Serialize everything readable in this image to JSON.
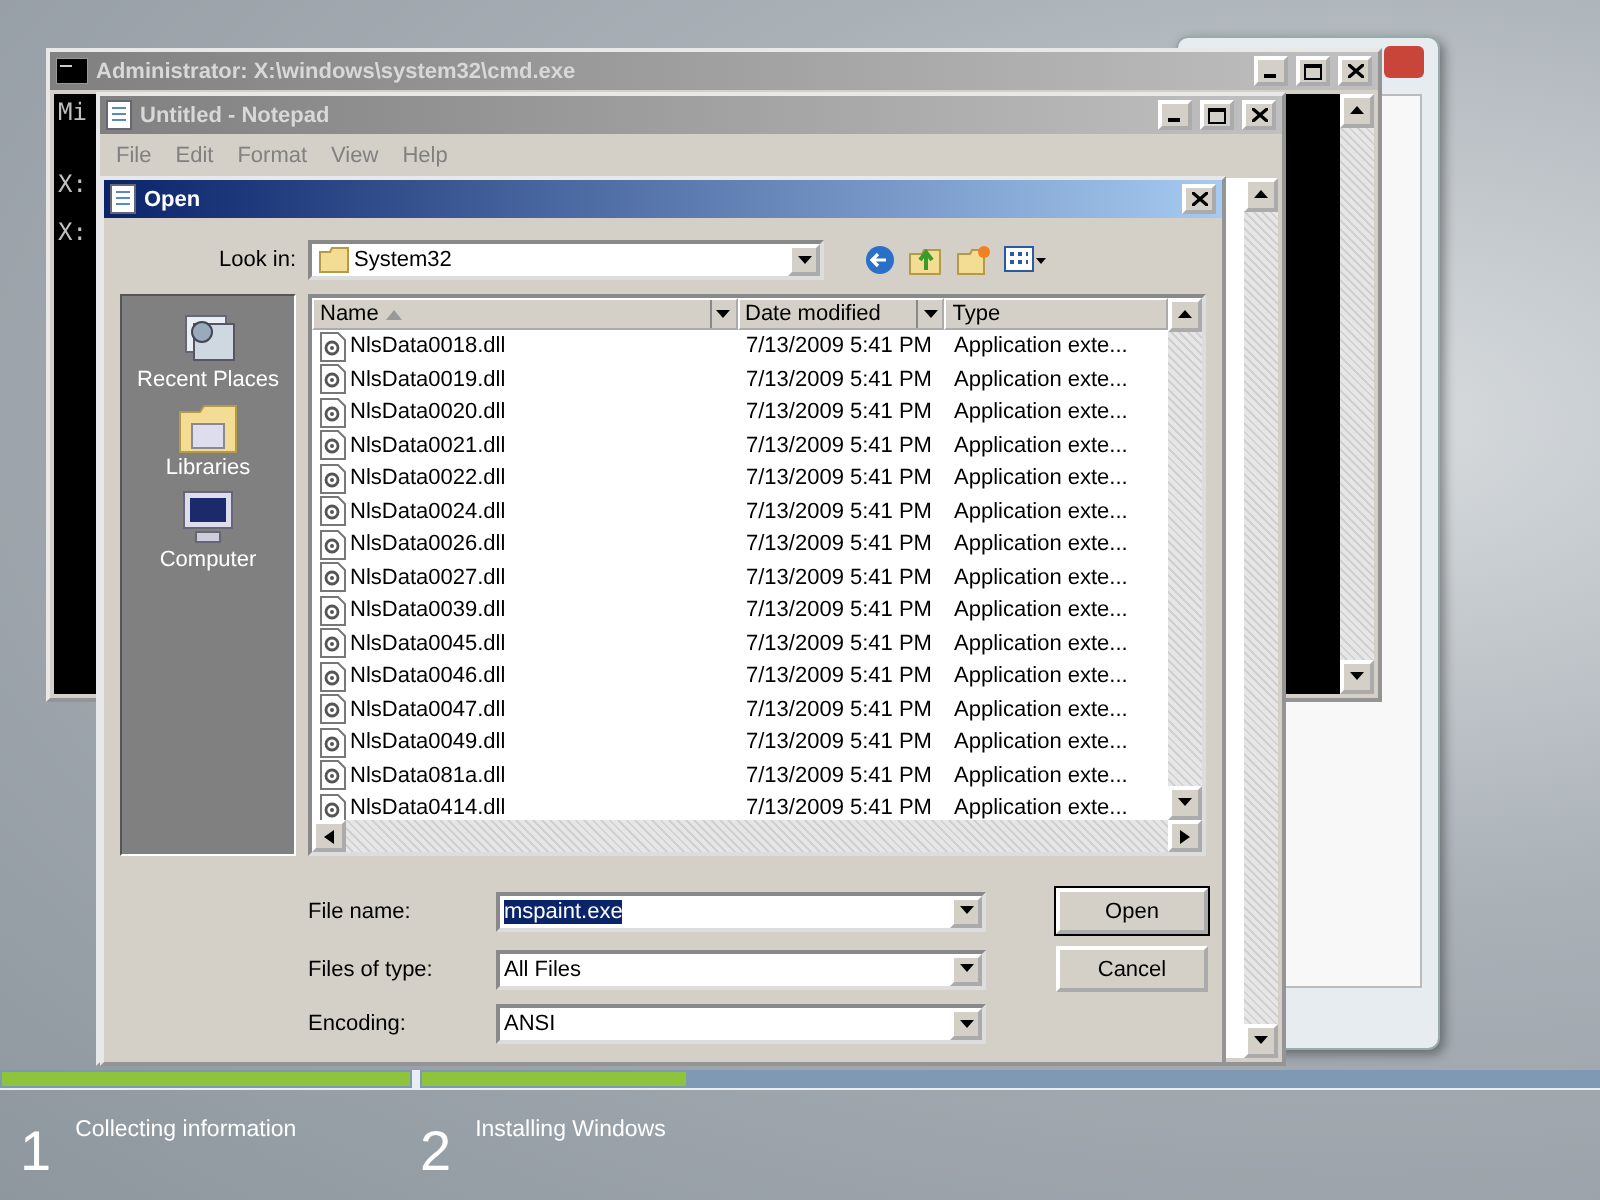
{
  "cmd_window": {
    "title": "Administrator: X:\\windows\\system32\\cmd.exe",
    "active": false,
    "lines": [
      "Mi",
      "X:",
      "X:"
    ]
  },
  "notepad": {
    "title": "Untitled - Notepad",
    "active": false,
    "menu": [
      "File",
      "Edit",
      "Format",
      "View",
      "Help"
    ]
  },
  "open_dialog": {
    "title": "Open",
    "active": true,
    "look_in_label": "Look in:",
    "look_in": "System32",
    "places": [
      {
        "label": "Recent Places",
        "kind": "recent"
      },
      {
        "label": "Libraries",
        "kind": "libraries"
      },
      {
        "label": "Computer",
        "kind": "computer"
      }
    ],
    "columns": [
      {
        "label": "Name",
        "sorted": true
      },
      {
        "label": "Date modified",
        "sorted": false
      },
      {
        "label": "Type",
        "sorted": false
      }
    ],
    "rows": [
      {
        "name": "NlsData0018.dll",
        "date": "7/13/2009 5:41 PM",
        "type": "Application exte..."
      },
      {
        "name": "NlsData0019.dll",
        "date": "7/13/2009 5:41 PM",
        "type": "Application exte..."
      },
      {
        "name": "NlsData0020.dll",
        "date": "7/13/2009 5:41 PM",
        "type": "Application exte..."
      },
      {
        "name": "NlsData0021.dll",
        "date": "7/13/2009 5:41 PM",
        "type": "Application exte..."
      },
      {
        "name": "NlsData0022.dll",
        "date": "7/13/2009 5:41 PM",
        "type": "Application exte..."
      },
      {
        "name": "NlsData0024.dll",
        "date": "7/13/2009 5:41 PM",
        "type": "Application exte..."
      },
      {
        "name": "NlsData0026.dll",
        "date": "7/13/2009 5:41 PM",
        "type": "Application exte..."
      },
      {
        "name": "NlsData0027.dll",
        "date": "7/13/2009 5:41 PM",
        "type": "Application exte..."
      },
      {
        "name": "NlsData0039.dll",
        "date": "7/13/2009 5:41 PM",
        "type": "Application exte..."
      },
      {
        "name": "NlsData0045.dll",
        "date": "7/13/2009 5:41 PM",
        "type": "Application exte..."
      },
      {
        "name": "NlsData0046.dll",
        "date": "7/13/2009 5:41 PM",
        "type": "Application exte..."
      },
      {
        "name": "NlsData0047.dll",
        "date": "7/13/2009 5:41 PM",
        "type": "Application exte..."
      },
      {
        "name": "NlsData0049.dll",
        "date": "7/13/2009 5:41 PM",
        "type": "Application exte..."
      },
      {
        "name": "NlsData081a.dll",
        "date": "7/13/2009 5:41 PM",
        "type": "Application exte..."
      },
      {
        "name": "NlsData0414.dll",
        "date": "7/13/2009 5:41 PM",
        "type": "Application exte..."
      }
    ],
    "fields": [
      {
        "label": "File name:",
        "value": "mspaint.exe",
        "highlighted": true
      },
      {
        "label": "Files of type:",
        "value": "All Files",
        "highlighted": false
      },
      {
        "label": "Encoding:",
        "value": "ANSI",
        "highlighted": false
      }
    ],
    "buttons": [
      {
        "label": "Open",
        "default": true
      },
      {
        "label": "Cancel",
        "default": false
      }
    ]
  },
  "setup_steps": [
    {
      "number": "1",
      "label": "Collecting information",
      "level": 1
    },
    {
      "number": "2",
      "label": "Installing Windows",
      "level": 0.225
    }
  ]
}
